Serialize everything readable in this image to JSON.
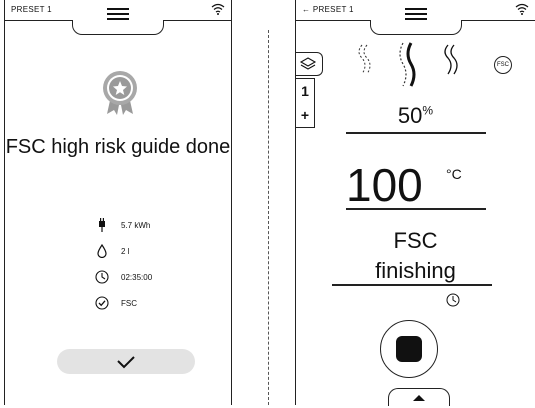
{
  "left": {
    "preset": "PRESET 1",
    "title": "FSC high risk guide done",
    "stats": [
      {
        "icon": "plug-icon",
        "value": "5.7 kWh"
      },
      {
        "icon": "water-drop-icon",
        "value": "2 l"
      },
      {
        "icon": "clock-icon",
        "value": "02:35:00"
      },
      {
        "icon": "check-circle-icon",
        "value": "FSC"
      }
    ]
  },
  "right": {
    "preset": "PRESET 1",
    "side_values": [
      "1",
      "+"
    ],
    "fan_percent": "50",
    "percent_unit": "%",
    "temperature": "100",
    "temp_unit": "°C",
    "program": "FSC",
    "program_step": "finishing",
    "fsc_badge": "FSC"
  }
}
